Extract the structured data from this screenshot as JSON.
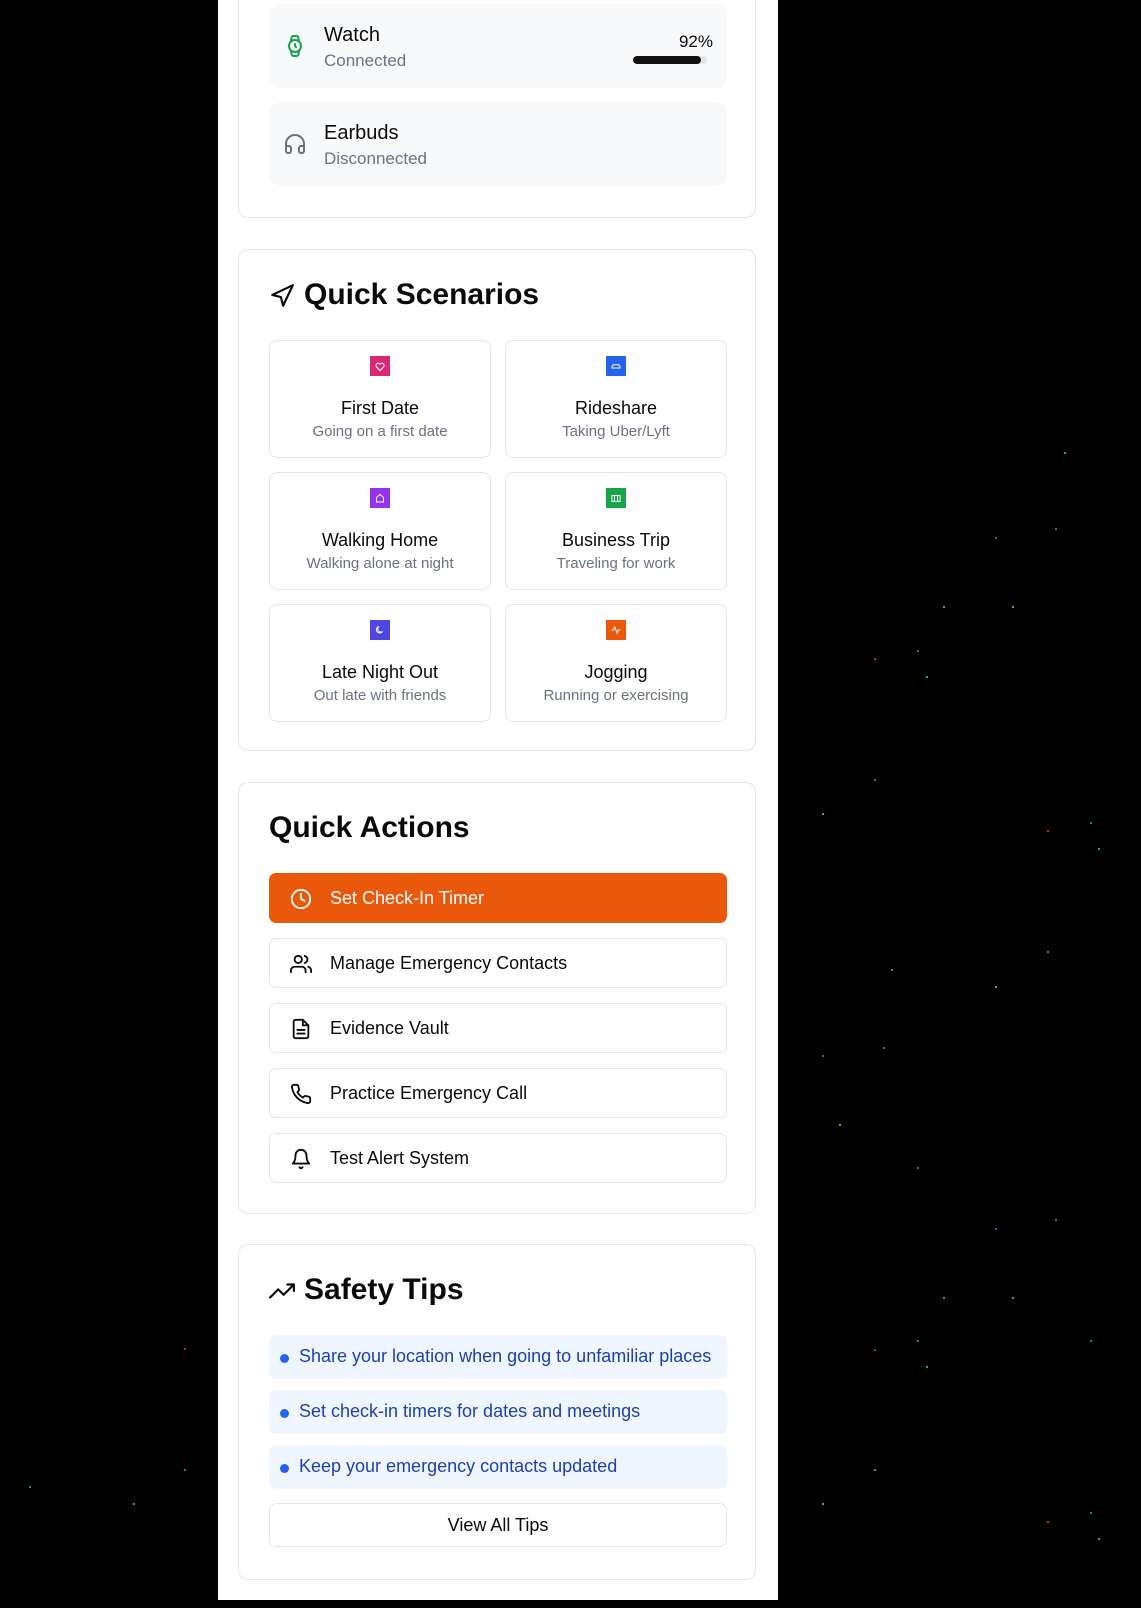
{
  "devices": [
    {
      "name": "Watch",
      "status": "Connected",
      "battery": "92%",
      "battery_level": 0.92,
      "icon": "watch-icon",
      "icon_color": "#16a34a"
    },
    {
      "name": "Earbuds",
      "status": "Disconnected",
      "icon": "headphones-icon",
      "icon_color": "#6b7280"
    }
  ],
  "scenarios": {
    "title": "Quick Scenarios",
    "icon": "navigation-icon",
    "items": [
      {
        "name": "First Date",
        "desc": "Going on a first date",
        "color": "#db2777",
        "icon": "heart-icon"
      },
      {
        "name": "Rideshare",
        "desc": "Taking Uber/Lyft",
        "color": "#2563eb",
        "icon": "car-icon"
      },
      {
        "name": "Walking Home",
        "desc": "Walking alone at night",
        "color": "#9333ea",
        "icon": "home-icon"
      },
      {
        "name": "Business Trip",
        "desc": "Traveling for work",
        "color": "#16a34a",
        "icon": "briefcase-icon"
      },
      {
        "name": "Late Night Out",
        "desc": "Out late with friends",
        "color": "#4f46e5",
        "icon": "moon-icon"
      },
      {
        "name": "Jogging",
        "desc": "Running or exercising",
        "color": "#ea580c",
        "icon": "activity-icon"
      }
    ]
  },
  "actions": {
    "title": "Quick Actions",
    "primary_color": "#ea580c",
    "items": [
      {
        "label": "Set Check-In Timer",
        "icon": "clock-icon"
      },
      {
        "label": "Manage Emergency Contacts",
        "icon": "users-icon"
      },
      {
        "label": "Evidence Vault",
        "icon": "file-text-icon"
      },
      {
        "label": "Practice Emergency Call",
        "icon": "phone-icon"
      },
      {
        "label": "Test Alert System",
        "icon": "bell-icon"
      }
    ]
  },
  "tips": {
    "title": "Safety Tips",
    "icon": "trending-up-icon",
    "items": [
      "Share your location when going to unfamiliar places",
      "Set check-in timers for dates and meetings",
      "Keep your emergency contacts updated"
    ],
    "view_all_label": "View All Tips"
  }
}
